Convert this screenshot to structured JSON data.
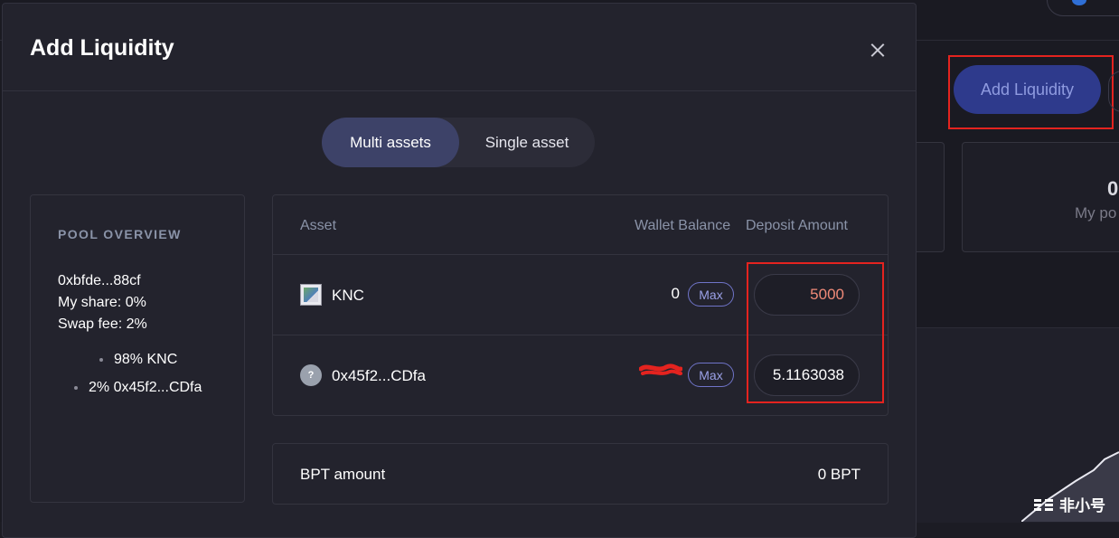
{
  "background": {
    "add_liquidity_label": "Add Liquidity",
    "card_value": "0",
    "card_label": "My po",
    "watermark": "非小号"
  },
  "modal": {
    "title": "Add Liquidity",
    "tabs": [
      {
        "label": "Multi assets",
        "active": true
      },
      {
        "label": "Single asset",
        "active": false
      }
    ],
    "pool_overview": {
      "title": "POOL OVERVIEW",
      "address": "0xbfde...88cf",
      "my_share": "My share: 0%",
      "swap_fee": "Swap fee: 2%",
      "composition": [
        "98% KNC",
        "2% 0x45f2...CDfa"
      ]
    },
    "table": {
      "headers": {
        "asset": "Asset",
        "wallet_balance": "Wallet Balance",
        "deposit_amount": "Deposit Amount"
      },
      "rows": [
        {
          "token": "KNC",
          "icon": "token-image-icon",
          "balance": "0",
          "max_label": "Max",
          "deposit": "5000"
        },
        {
          "token": "0x45f2...CDfa",
          "icon": "unknown-token-icon",
          "icon_glyph": "?",
          "balance": "",
          "max_label": "Max",
          "deposit": "5.1163038"
        }
      ]
    },
    "bpt": {
      "label": "BPT amount",
      "value": "0 BPT"
    }
  },
  "colors": {
    "accent": "#3d4268",
    "max_border": "#6f74c8",
    "deposit_highlight": "#f08a78",
    "annotation_red": "#e4231f"
  }
}
